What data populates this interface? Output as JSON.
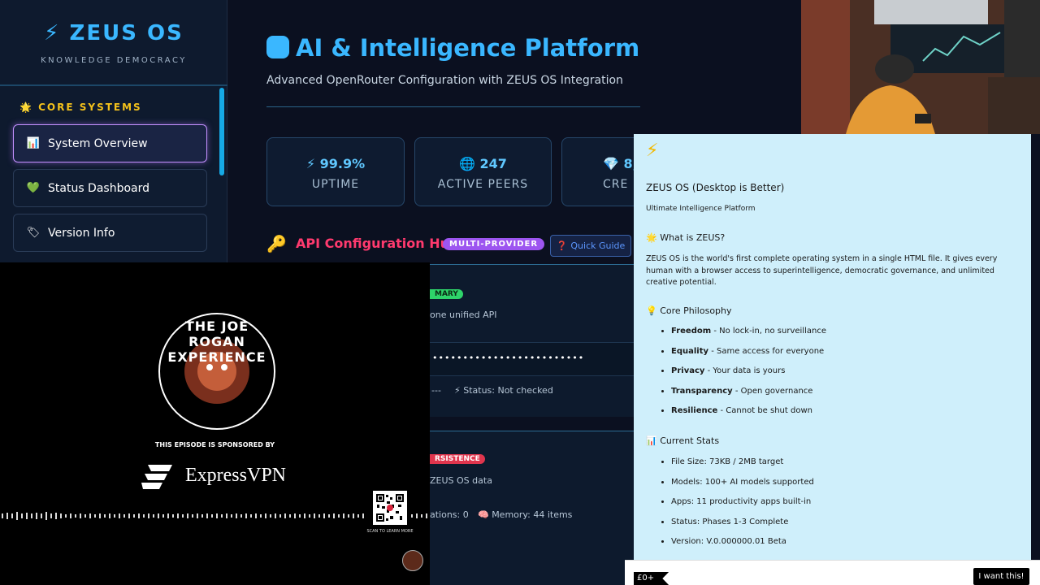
{
  "sidebar": {
    "logo": "⚡ ZEUS OS",
    "tagline": "KNOWLEDGE DEMOCRACY",
    "section_title": "🌟 CORE SYSTEMS",
    "items": [
      {
        "icon": "📊",
        "label": "System Overview",
        "active": true
      },
      {
        "icon": "💚",
        "label": "Status Dashboard",
        "active": false
      },
      {
        "icon": "🏷",
        "label": "Version Info",
        "active": false
      }
    ]
  },
  "main": {
    "title": "AI & Intelligence Platform",
    "subtitle": "Advanced OpenRouter Configuration with ZEUS OS Integration",
    "stats": [
      {
        "value": "⚡ 99.9%",
        "label": "UPTIME"
      },
      {
        "value": "🌐 247",
        "label": "ACTIVE PEERS"
      },
      {
        "value": "💎 8,",
        "label": "CRE"
      }
    ],
    "api_hub": {
      "title": "API Configuration Hub",
      "badge": "MULTI-PROVIDER",
      "guide_button": "Quick Guide",
      "primary_badge": "MARY",
      "primary_text": "one unified API",
      "key_mask": "•••••••••••••••••••••••••",
      "status_prefix": "---",
      "status_text": "⚡ Status: Not checked",
      "persistence_badge": "RSISTENCE",
      "persistence_text": "ZEUS OS data",
      "conversations_text": "ations: 0",
      "memory_text": "🧠 Memory: 44 items"
    }
  },
  "podcast": {
    "show_name": "THE JOE ROGAN EXPERIENCE",
    "sponsor_line": "THIS EPISODE IS SPONSORED BY",
    "sponsor_name": "ExpressVPN",
    "qr_caption": "SCAN TO LEARN MORE"
  },
  "info": {
    "title": "ZEUS OS (Desktop is Better)",
    "subtitle": "Ultimate Intelligence Platform",
    "what_heading": "🌟 What is ZEUS?",
    "what_body": "ZEUS OS is the world's first complete operating system in a single HTML file. It gives every human with a browser access to superintelligence, democratic governance, and unlimited creative potential.",
    "philosophy_heading": "💡 Core Philosophy",
    "philosophy": [
      {
        "term": "Freedom",
        "desc": " - No lock-in, no surveillance"
      },
      {
        "term": "Equality",
        "desc": " - Same access for everyone"
      },
      {
        "term": "Privacy",
        "desc": " - Your data is yours"
      },
      {
        "term": "Transparency",
        "desc": " - Open governance"
      },
      {
        "term": "Resilience",
        "desc": " - Cannot be shut down"
      }
    ],
    "stats_heading": "📊 Current Stats",
    "stats": [
      "File Size: 73KB / 2MB target",
      "Models: 100+ AI models supported",
      "Apps: 11 productivity apps built-in",
      "Status: Phases 1-3 Complete",
      "Version: V.0.000000.01 Beta"
    ],
    "price": "£0+",
    "cta": "I want this!"
  }
}
